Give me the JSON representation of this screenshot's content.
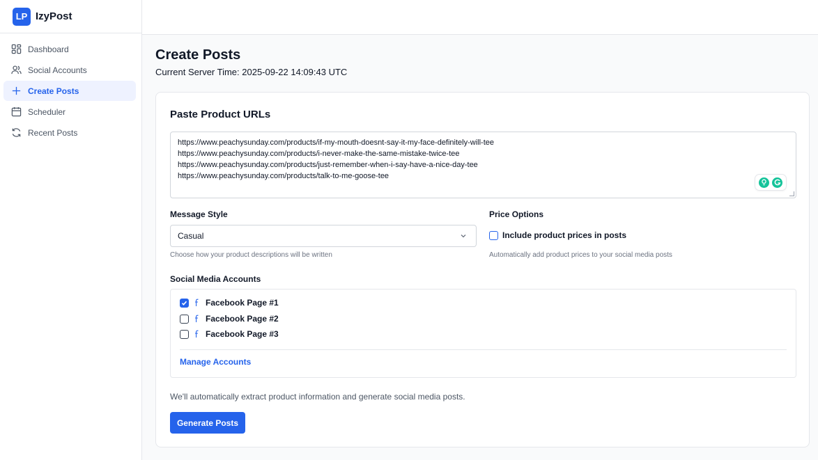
{
  "app": {
    "logo_text": "LP",
    "name": "IzyPost",
    "accent_color": "#2563eb"
  },
  "sidebar": {
    "items": [
      {
        "label": "Dashboard",
        "icon": "dashboard-icon",
        "active": false
      },
      {
        "label": "Social Accounts",
        "icon": "users-icon",
        "active": false
      },
      {
        "label": "Create Posts",
        "icon": "plus-icon",
        "active": true
      },
      {
        "label": "Scheduler",
        "icon": "calendar-icon",
        "active": false
      },
      {
        "label": "Recent Posts",
        "icon": "refresh-icon",
        "active": false
      }
    ]
  },
  "header": {
    "title": "Create Posts",
    "server_time": "Current Server Time: 2025-09-22 14:09:43 UTC"
  },
  "form": {
    "urls_title": "Paste Product URLs",
    "urls": [
      "https://www.peachysunday.com/products/if-my-mouth-doesnt-say-it-my-face-definitely-will-tee",
      "https://www.peachysunday.com/products/i-never-make-the-same-mistake-twice-tee",
      "https://www.peachysunday.com/products/just-remember-when-i-say-have-a-nice-day-tee",
      "https://www.peachysunday.com/products/talk-to-me-goose-tee"
    ],
    "message_style": {
      "label": "Message Style",
      "value": "Casual",
      "hint": "Choose how your product descriptions will be written"
    },
    "price_options": {
      "label": "Price Options",
      "checkbox_label": "Include product prices in posts",
      "checked": false,
      "hint": "Automatically add product prices to your social media posts"
    },
    "accounts": {
      "label": "Social Media Accounts",
      "items": [
        {
          "label": "Facebook Page #1",
          "checked": true
        },
        {
          "label": "Facebook Page #2",
          "checked": false
        },
        {
          "label": "Facebook Page #3",
          "checked": false
        }
      ],
      "manage_link": "Manage Accounts"
    },
    "footer_note": "We'll automatically extract product information and generate social media posts.",
    "submit_label": "Generate Posts"
  }
}
